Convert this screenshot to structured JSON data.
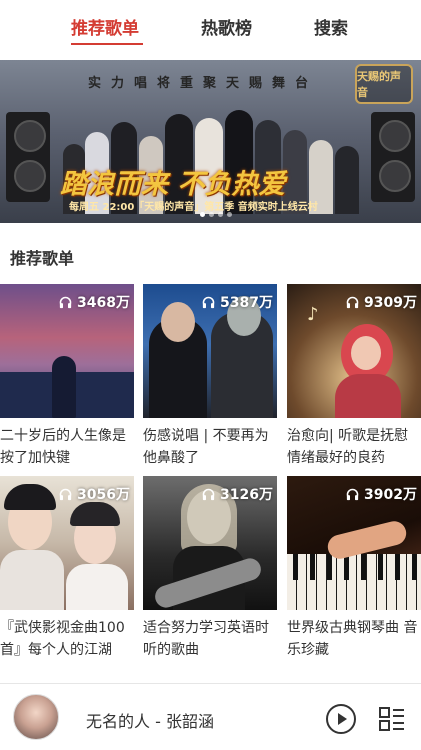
{
  "tabs": [
    {
      "label": "推荐歌单",
      "active": true
    },
    {
      "label": "热歌榜",
      "active": false
    },
    {
      "label": "搜索",
      "active": false
    }
  ],
  "banner": {
    "top_text": "实力唱将重聚天赐舞台",
    "logo_text": "天赐的声音",
    "headline": "踏浪而来 不负热爱",
    "caption": "每周五 22:00「天赐的声音」第五季 音频实时上线云村"
  },
  "section_title": "推荐歌单",
  "playlists": [
    {
      "title": "二十岁后的人生像是按了加快键",
      "play_count": "3468万",
      "icon": "headphones-icon"
    },
    {
      "title": "伤感说唱 | 不要再为他鼻酸了",
      "play_count": "5387万",
      "icon": "headphones-icon"
    },
    {
      "title": "治愈向| 听歌是抚慰情绪最好的良药",
      "play_count": "9309万",
      "icon": "headphones-icon"
    },
    {
      "title": "『武侠影视金曲100首』每个人的江湖",
      "play_count": "3056万",
      "icon": "headphones-icon"
    },
    {
      "title": "适合努力学习英语时听的歌曲",
      "play_count": "3126万",
      "icon": "headphones-icon"
    },
    {
      "title": "世界级古典钢琴曲 音乐珍藏",
      "play_count": "3902万",
      "icon": "headphones-icon"
    }
  ],
  "player": {
    "song": "无名的人 - 张韶涵",
    "play_icon": "play-circle-icon",
    "list_icon": "playlist-icon"
  },
  "colors": {
    "accent": "#d43c33",
    "text": "#333333"
  }
}
